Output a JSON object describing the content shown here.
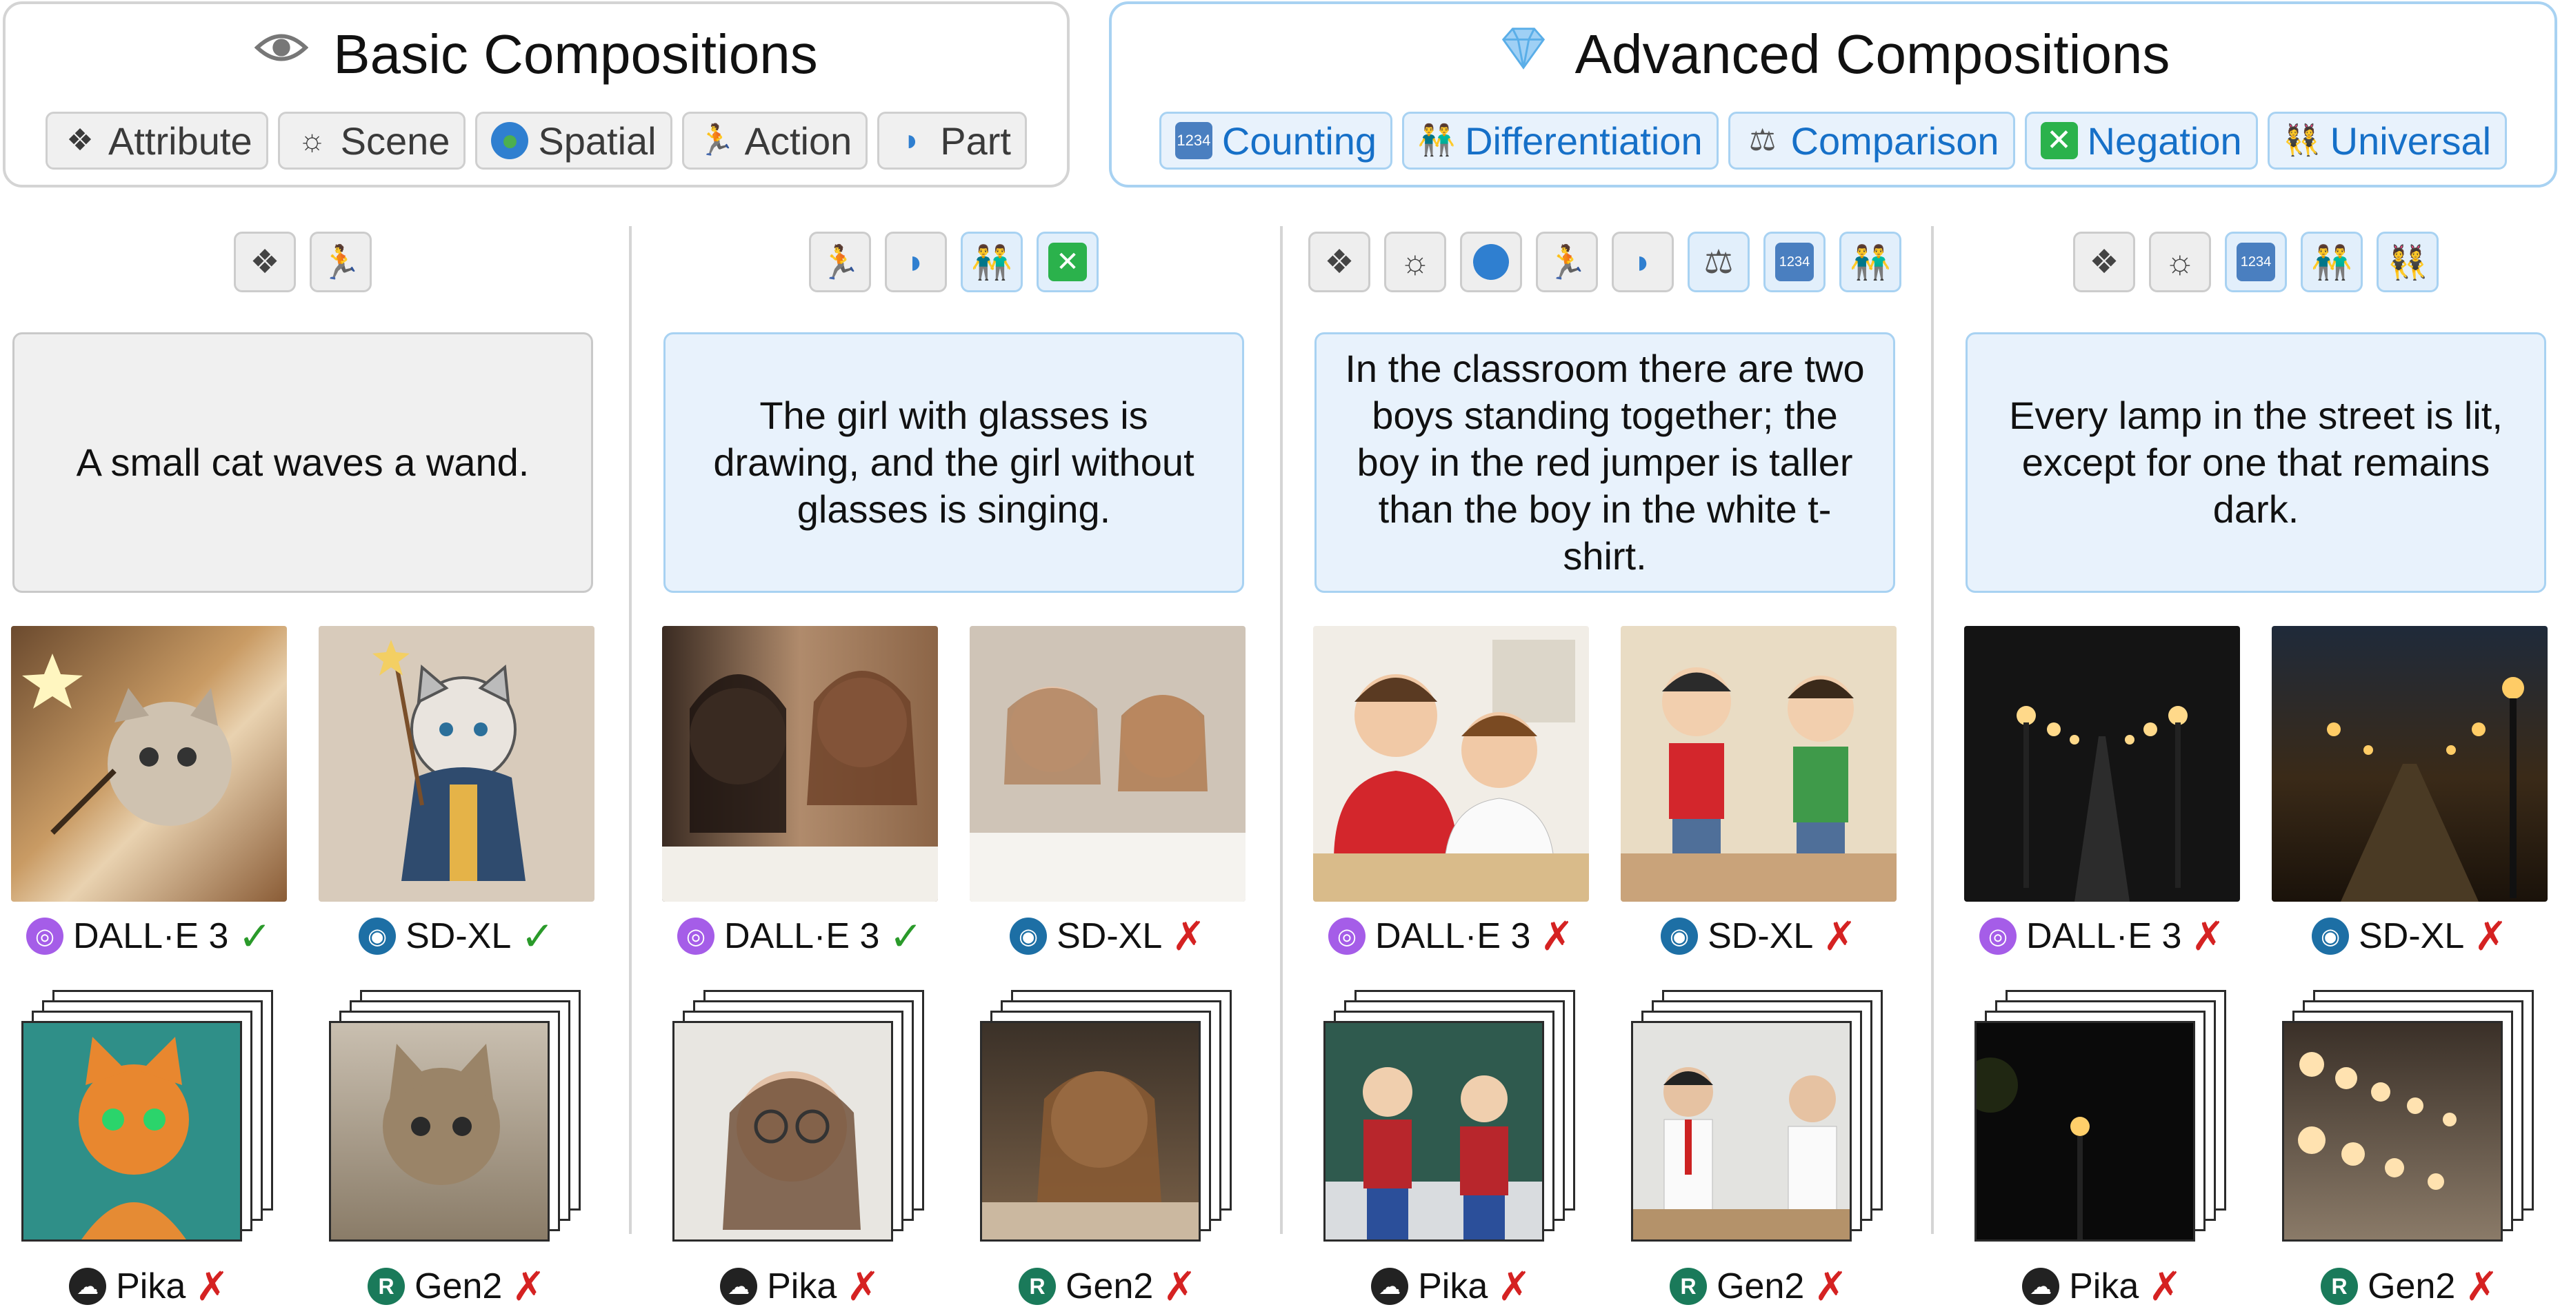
{
  "basic": {
    "title": "Basic Compositions",
    "tags": [
      "Attribute",
      "Scene",
      "Spatial",
      "Action",
      "Part"
    ]
  },
  "advanced": {
    "title": "Advanced Compositions",
    "tags": [
      "Counting",
      "Differentiation",
      "Comparison",
      "Negation",
      "Universal"
    ]
  },
  "columns": [
    {
      "prompt": "A small cat waves a wand.",
      "models": [
        {
          "name": "DALL·E 3",
          "result": "✓"
        },
        {
          "name": "SD-XL",
          "result": "✓"
        },
        {
          "name": "Pika",
          "result": "✗"
        },
        {
          "name": "Gen2",
          "result": "✗"
        }
      ]
    },
    {
      "prompt": "The girl with glasses is drawing, and the girl without glasses is singing.",
      "models": [
        {
          "name": "DALL·E 3",
          "result": "✓"
        },
        {
          "name": "SD-XL",
          "result": "✗"
        },
        {
          "name": "Pika",
          "result": "✗"
        },
        {
          "name": "Gen2",
          "result": "✗"
        }
      ]
    },
    {
      "prompt": "In the classroom there are two boys standing together; the boy in the red jumper is taller than the boy in the white t-shirt.",
      "models": [
        {
          "name": "DALL·E 3",
          "result": "✗"
        },
        {
          "name": "SD-XL",
          "result": "✗"
        },
        {
          "name": "Pika",
          "result": "✗"
        },
        {
          "name": "Gen2",
          "result": "✗"
        }
      ]
    },
    {
      "prompt": "Every lamp in the street is lit, except for one that remains dark.",
      "models": [
        {
          "name": "DALL·E 3",
          "result": "✗"
        },
        {
          "name": "SD-XL",
          "result": "✗"
        },
        {
          "name": "Pika",
          "result": "✗"
        },
        {
          "name": "Gen2",
          "result": "✗"
        }
      ]
    }
  ],
  "colors": {
    "basic_border": "#d4d4d4",
    "advanced_border": "#a8d2f2",
    "advanced_text": "#1670c8",
    "check": "#2a9a2a",
    "cross": "#d52222"
  }
}
